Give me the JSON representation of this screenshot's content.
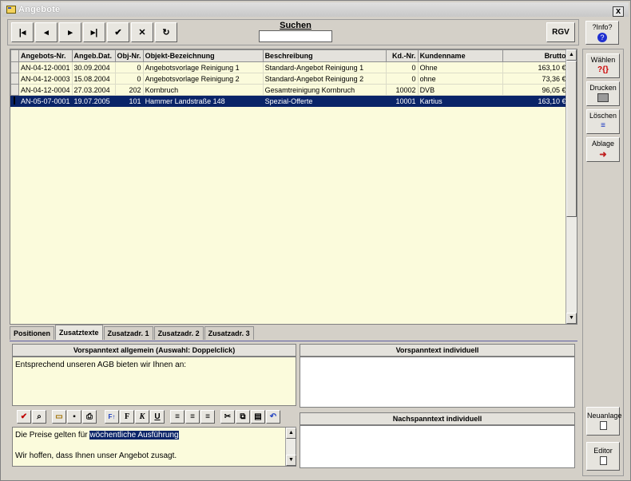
{
  "window": {
    "title": "Angebote",
    "close_label": "x"
  },
  "toolbar": {
    "search_label": "Suchen",
    "search_value": "",
    "rgv_label": "RGV",
    "info_label": "?Info?"
  },
  "side_buttons": {
    "waehlen": "Wählen",
    "drucken": "Drucken",
    "loeschen": "Löschen",
    "ablage": "Ablage",
    "neuanlage": "Neuanlage",
    "editor": "Editor"
  },
  "table": {
    "columns": [
      "Angebots-Nr.",
      "Angeb.Dat.",
      "Obj-Nr.",
      "Objekt-Bezeichnung",
      "Beschreibung",
      "Kd.-Nr.",
      "Kundenname",
      "Brutto"
    ],
    "rows": [
      [
        "AN-04-12-0001",
        "30.09.2004",
        "0",
        "Angebotsvorlage Reinigung 1",
        "Standard-Angebot Reinigung 1",
        "0",
        "Ohne",
        "163,10 €"
      ],
      [
        "AN-04-12-0003",
        "15.08.2004",
        "0",
        "Angebotsvorlage Reinigung 2",
        "Standard-Angebot Reinigung 2",
        "0",
        "ohne",
        "73,36 €"
      ],
      [
        "AN-04-12-0004",
        "27.03.2004",
        "202",
        "Kornbruch",
        "Gesamtreinigung Kornbruch",
        "10002",
        "DVB",
        "96,05 €"
      ],
      [
        "AN-05-07-0001",
        "19.07.2005",
        "101",
        "Hammer Landstraße 148",
        "Spezial-Offerte",
        "10001",
        "Kartius",
        "163,10 €"
      ]
    ],
    "selected_row": 3
  },
  "tabs": [
    "Positionen",
    "Zusatztexte",
    "Zusatzadr. 1",
    "Zusatzadr. 2",
    "Zusatzadr. 3"
  ],
  "active_tab": 1,
  "panels": {
    "vorspann_allgemein_header": "Vorspanntext allgemein (Auswahl: Doppelclick)",
    "vorspann_allgemein_text": "Entsprechend unseren AGB bieten wir Ihnen an:",
    "vorspann_individuell_header": "Vorspanntext individuell",
    "nachspann_individuell_header": "Nachspanntext individuell",
    "editor_line1_plain": "Die Preise gelten für ",
    "editor_line1_selected": "wöchentliche Ausführung",
    "editor_line2": "Wir hoffen, dass Ihnen unser Angebot zusagt."
  },
  "colors": {
    "selection": "#0a2468",
    "grid_bg": "#fbfbdc",
    "window_bg": "#d4d0c8"
  }
}
